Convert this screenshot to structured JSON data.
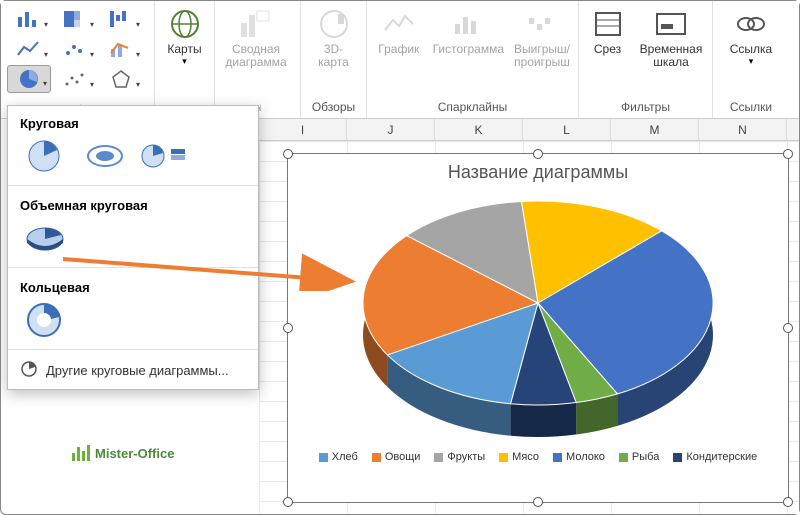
{
  "columns": [
    "I",
    "J",
    "K",
    "L",
    "M",
    "N"
  ],
  "ribbon": {
    "charts_group_label": "",
    "maps_label": "Карты",
    "pivotchart_label": "Сводная\nдиаграмма",
    "map3d_label": "3D-\nкарта",
    "tours_group": "Обзоры",
    "spark_line": "График",
    "spark_col": "Гистограмма",
    "spark_wl": "Выигрыш/\nпроигрыш",
    "spark_group": "Спарклайны",
    "slicer": "Срез",
    "timeline": "Временная\nшкала",
    "filters_group": "Фильтры",
    "link": "Ссылка",
    "links_group": "Ссылки"
  },
  "dropdown": {
    "pie_title": "Круговая",
    "pie3d_title": "Объемная круговая",
    "donut_title": "Кольцевая",
    "more": "Другие круговые диаграммы..."
  },
  "chart_title": "Название диаграммы",
  "watermark": "Mister-Office",
  "chart_data": {
    "type": "pie",
    "title": "Название диаграммы",
    "series": [
      {
        "name": "Хлеб",
        "value": 14,
        "color": "#5b9bd5"
      },
      {
        "name": "Овощи",
        "value": 20,
        "color": "#ed7d31"
      },
      {
        "name": "Фрукты",
        "value": 12,
        "color": "#a5a5a5"
      },
      {
        "name": "Мясо",
        "value": 14,
        "color": "#ffc000"
      },
      {
        "name": "Молоко",
        "value": 30,
        "color": "#4472c4"
      },
      {
        "name": "Рыба",
        "value": 4,
        "color": "#70ad47"
      },
      {
        "name": "Кондитерские",
        "value": 6,
        "color": "#264478"
      }
    ],
    "legend_position": "bottom",
    "is_3d": true
  }
}
